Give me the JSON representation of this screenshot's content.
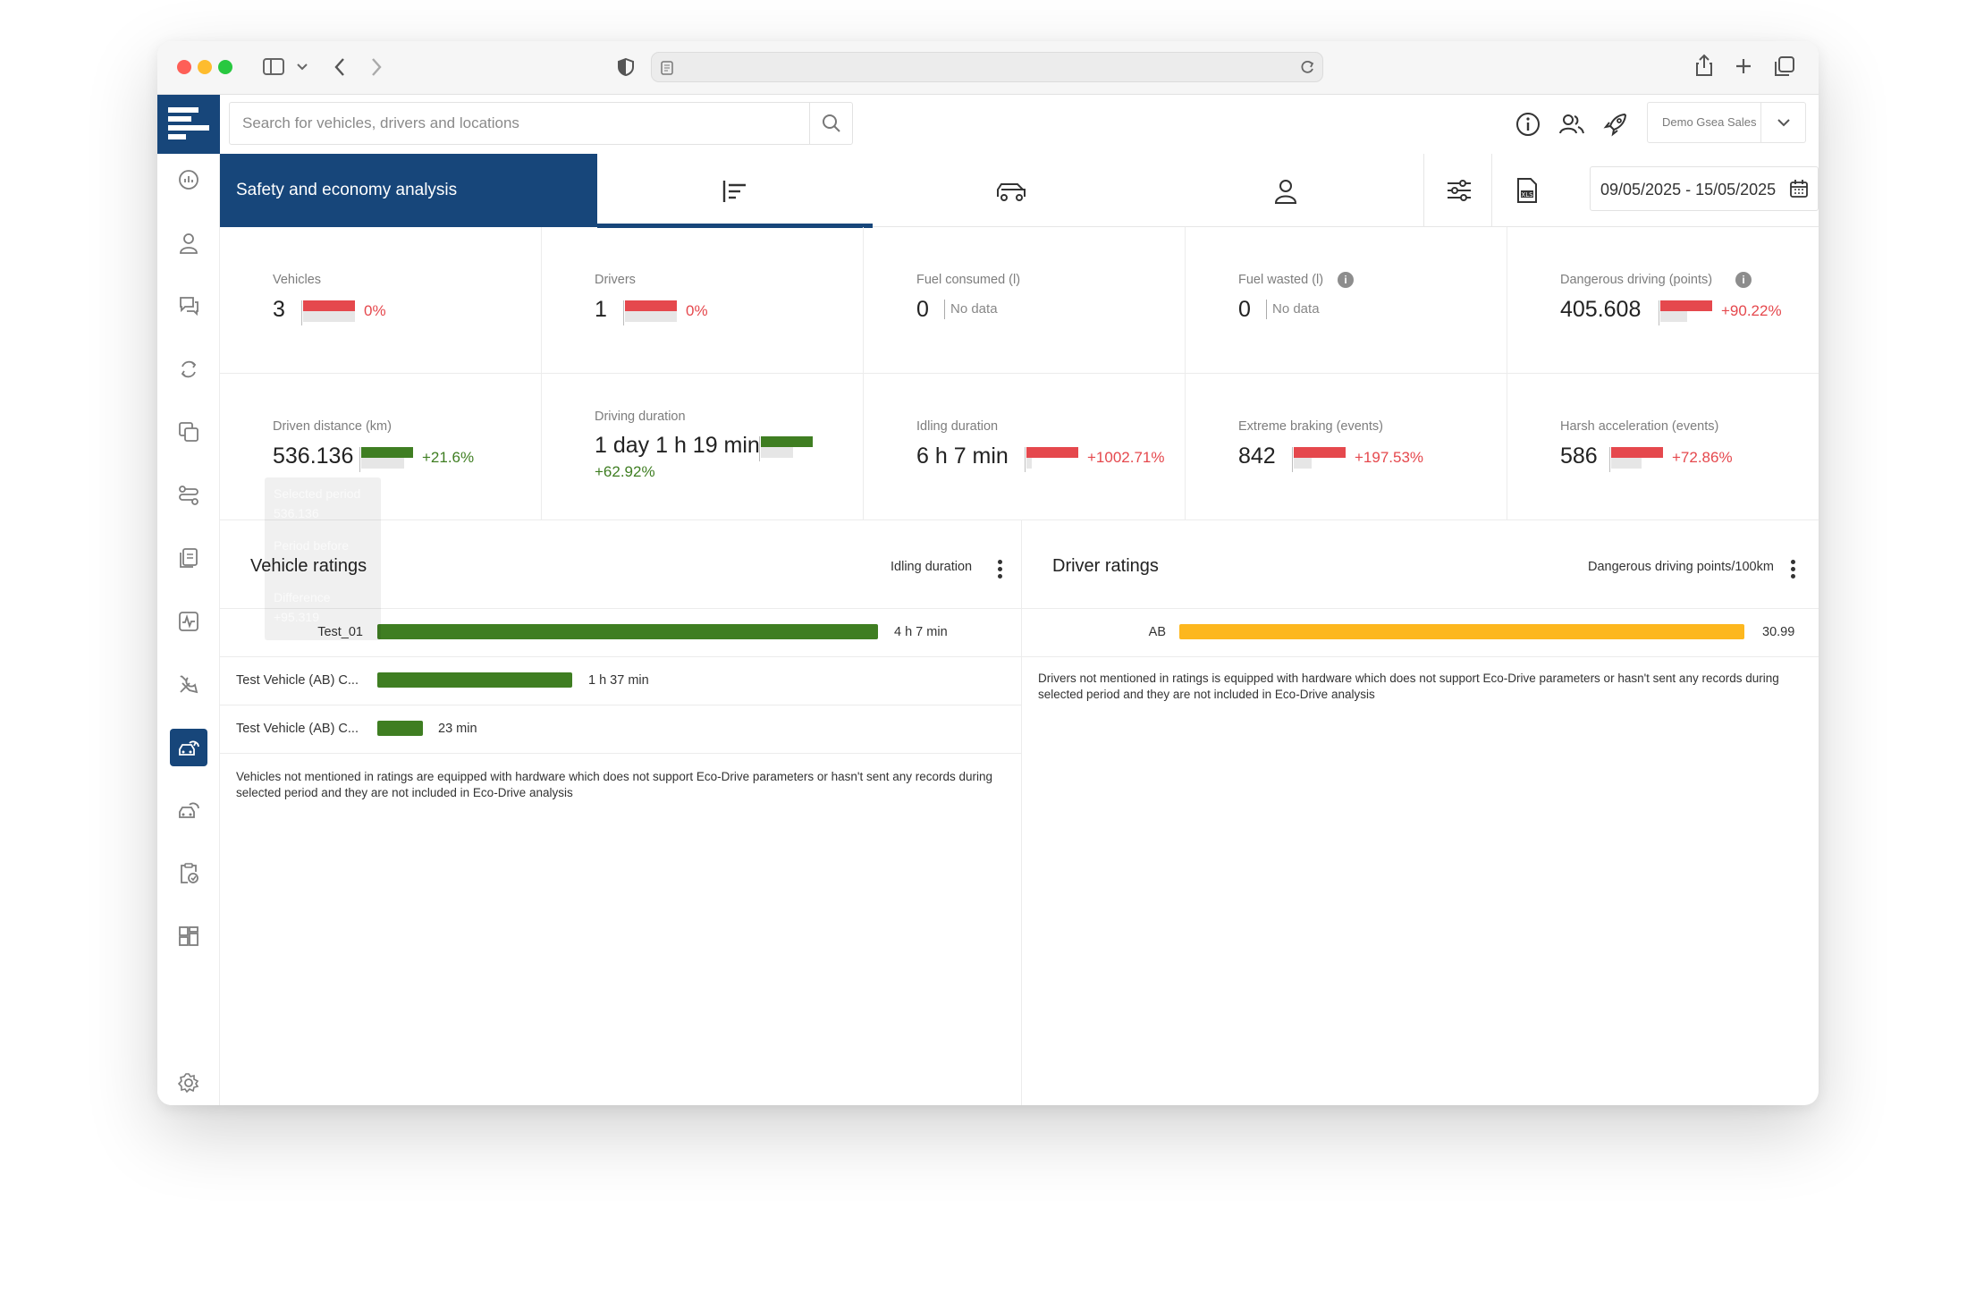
{
  "browser": {
    "url": ""
  },
  "search": {
    "placeholder": "Search for vehicles, drivers and locations"
  },
  "account": {
    "name": "Demo Gsea Sales"
  },
  "page": {
    "title": "Safety and economy analysis",
    "date_range": "09/05/2025 - 15/05/2025"
  },
  "kpis": [
    {
      "label": "Vehicles",
      "value": "3",
      "change": "0%",
      "trend": "red"
    },
    {
      "label": "Drivers",
      "value": "1",
      "change": "0%",
      "trend": "red"
    },
    {
      "label": "Fuel consumed (l)",
      "value": "0",
      "note": "No data"
    },
    {
      "label": "Fuel wasted (l)",
      "value": "0",
      "note": "No data",
      "info": "i"
    },
    {
      "label": "Dangerous driving (points)",
      "value": "405.608",
      "change": "+90.22%",
      "trend": "red",
      "info": "i"
    },
    {
      "label": "Driven distance (km)",
      "value": "536.136",
      "change": "+21.6%",
      "trend": "green"
    },
    {
      "label": "Driving duration",
      "value": "1 day 1 h 19 min",
      "change": "+62.92%",
      "trend": "green"
    },
    {
      "label": "Idling duration",
      "value": "6 h 7 min",
      "change": "+1002.71%",
      "trend": "red"
    },
    {
      "label": "Extreme braking (events)",
      "value": "842",
      "change": "+197.53%",
      "trend": "red"
    },
    {
      "label": "Harsh acceleration (events)",
      "value": "586",
      "change": "+72.86%",
      "trend": "red"
    }
  ],
  "tooltip": {
    "l1": "Selected period",
    "v1": "536.136",
    "l2": "Period before",
    "l3": "Difference",
    "v3": "+95.319"
  },
  "vehicle_ratings": {
    "title": "Vehicle ratings",
    "metric": "Idling duration",
    "rows": [
      {
        "name": "Test_01",
        "value": "4 h 7 min",
        "fraction": 1.0
      },
      {
        "name": "Test Vehicle (AB) C...",
        "value": "1 h 37 min",
        "fraction": 0.39
      },
      {
        "name": "Test Vehicle (AB) C...",
        "value": "23 min",
        "fraction": 0.092
      }
    ],
    "note": "Vehicles not mentioned in ratings are equipped with hardware which does not support Eco-Drive parameters or hasn't sent any records during selected period and they are not included in Eco-Drive analysis"
  },
  "driver_ratings": {
    "title": "Driver ratings",
    "metric": "Dangerous driving points/100km",
    "rows": [
      {
        "name": "AB",
        "value": "30.99",
        "fraction": 1.0
      }
    ],
    "note": "Drivers not mentioned in ratings is equipped with hardware which does not support Eco-Drive parameters or hasn't sent any records during selected period and they are not included in Eco-Drive analysis"
  },
  "colors": {
    "brand": "#17467a",
    "green": "#3f7e22",
    "red": "#e5484d",
    "amber": "#fdb71e"
  }
}
